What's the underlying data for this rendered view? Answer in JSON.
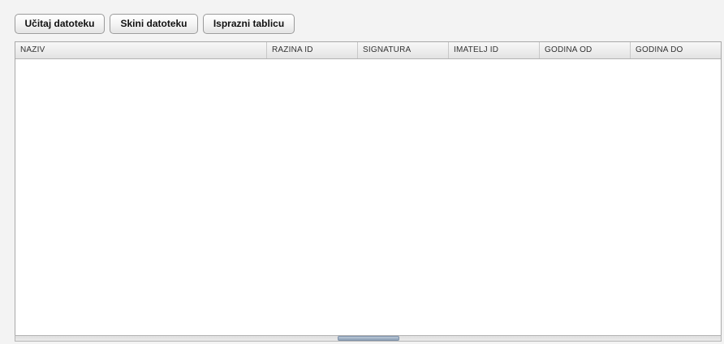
{
  "toolbar": {
    "load_label": "Učitaj datoteku",
    "download_label": "Skini datoteku",
    "clear_label": "Isprazni tablicu"
  },
  "table": {
    "columns": [
      "NAZIV",
      "RAZINA ID",
      "SIGNATURA",
      "IMATELJ ID",
      "GODINA OD",
      "GODINA DO"
    ],
    "rows": []
  }
}
